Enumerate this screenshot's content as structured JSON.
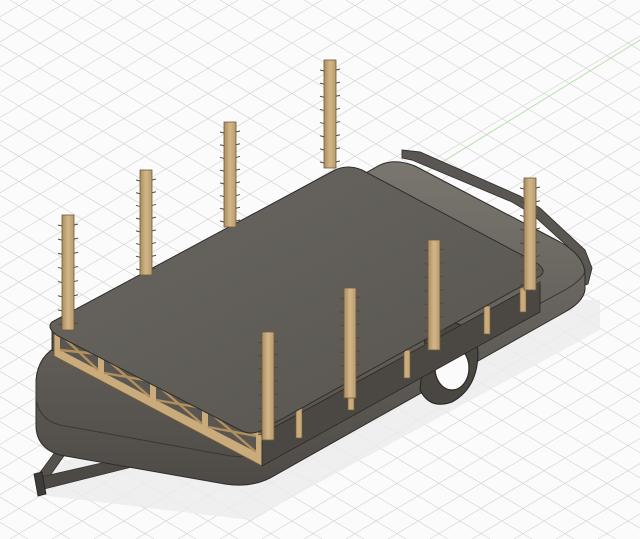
{
  "viewport": {
    "background": "#fbfbfb",
    "grid_color": "#d6d6d6",
    "axis_color": "#b9dcb0",
    "model": {
      "name": "trailer-frame-model",
      "deck_color": "#5f5c57",
      "frame_color": "#6a6660",
      "timber_color": "#c9ab7c",
      "timber_edge_color": "#6f5a3a",
      "shadow_color": "#e5e5e5",
      "post_count": 8,
      "truss_panel_count": 4
    }
  }
}
